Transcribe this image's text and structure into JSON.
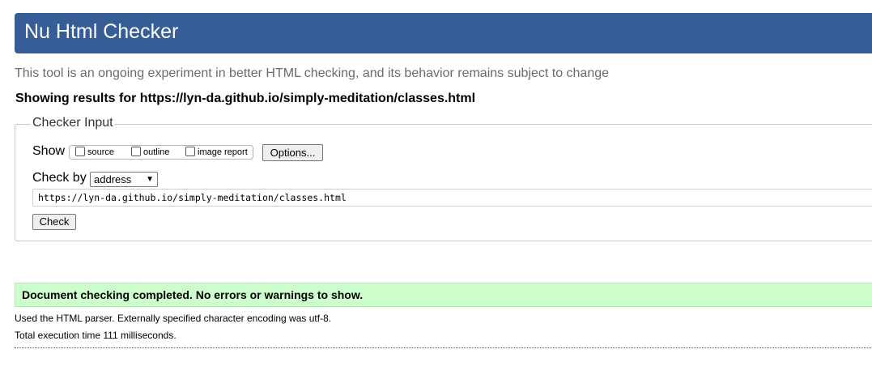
{
  "header": {
    "title": "Nu Html Checker",
    "background_color": "#365d95"
  },
  "tagline": "This tool is an ongoing experiment in better HTML checking, and its behavior remains subject to change",
  "results_for": "Showing results for https://lyn-da.github.io/simply-meditation/classes.html",
  "checker_input": {
    "legend": "Checker Input",
    "show_label": "Show",
    "show_options": [
      {
        "label": "source",
        "checked": false
      },
      {
        "label": "outline",
        "checked": false
      },
      {
        "label": "image report",
        "checked": false
      }
    ],
    "options_button": "Options...",
    "check_by_label": "Check by",
    "check_by_selected": "address",
    "url_value": "https://lyn-da.github.io/simply-meditation/classes.html",
    "check_button": "Check"
  },
  "result": {
    "message": "Document checking completed. No errors or warnings to show.",
    "background_color": "#ccffcc"
  },
  "details": {
    "parser_info": "Used the HTML parser. Externally specified character encoding was utf-8.",
    "execution_time": "Total execution time 111 milliseconds."
  }
}
